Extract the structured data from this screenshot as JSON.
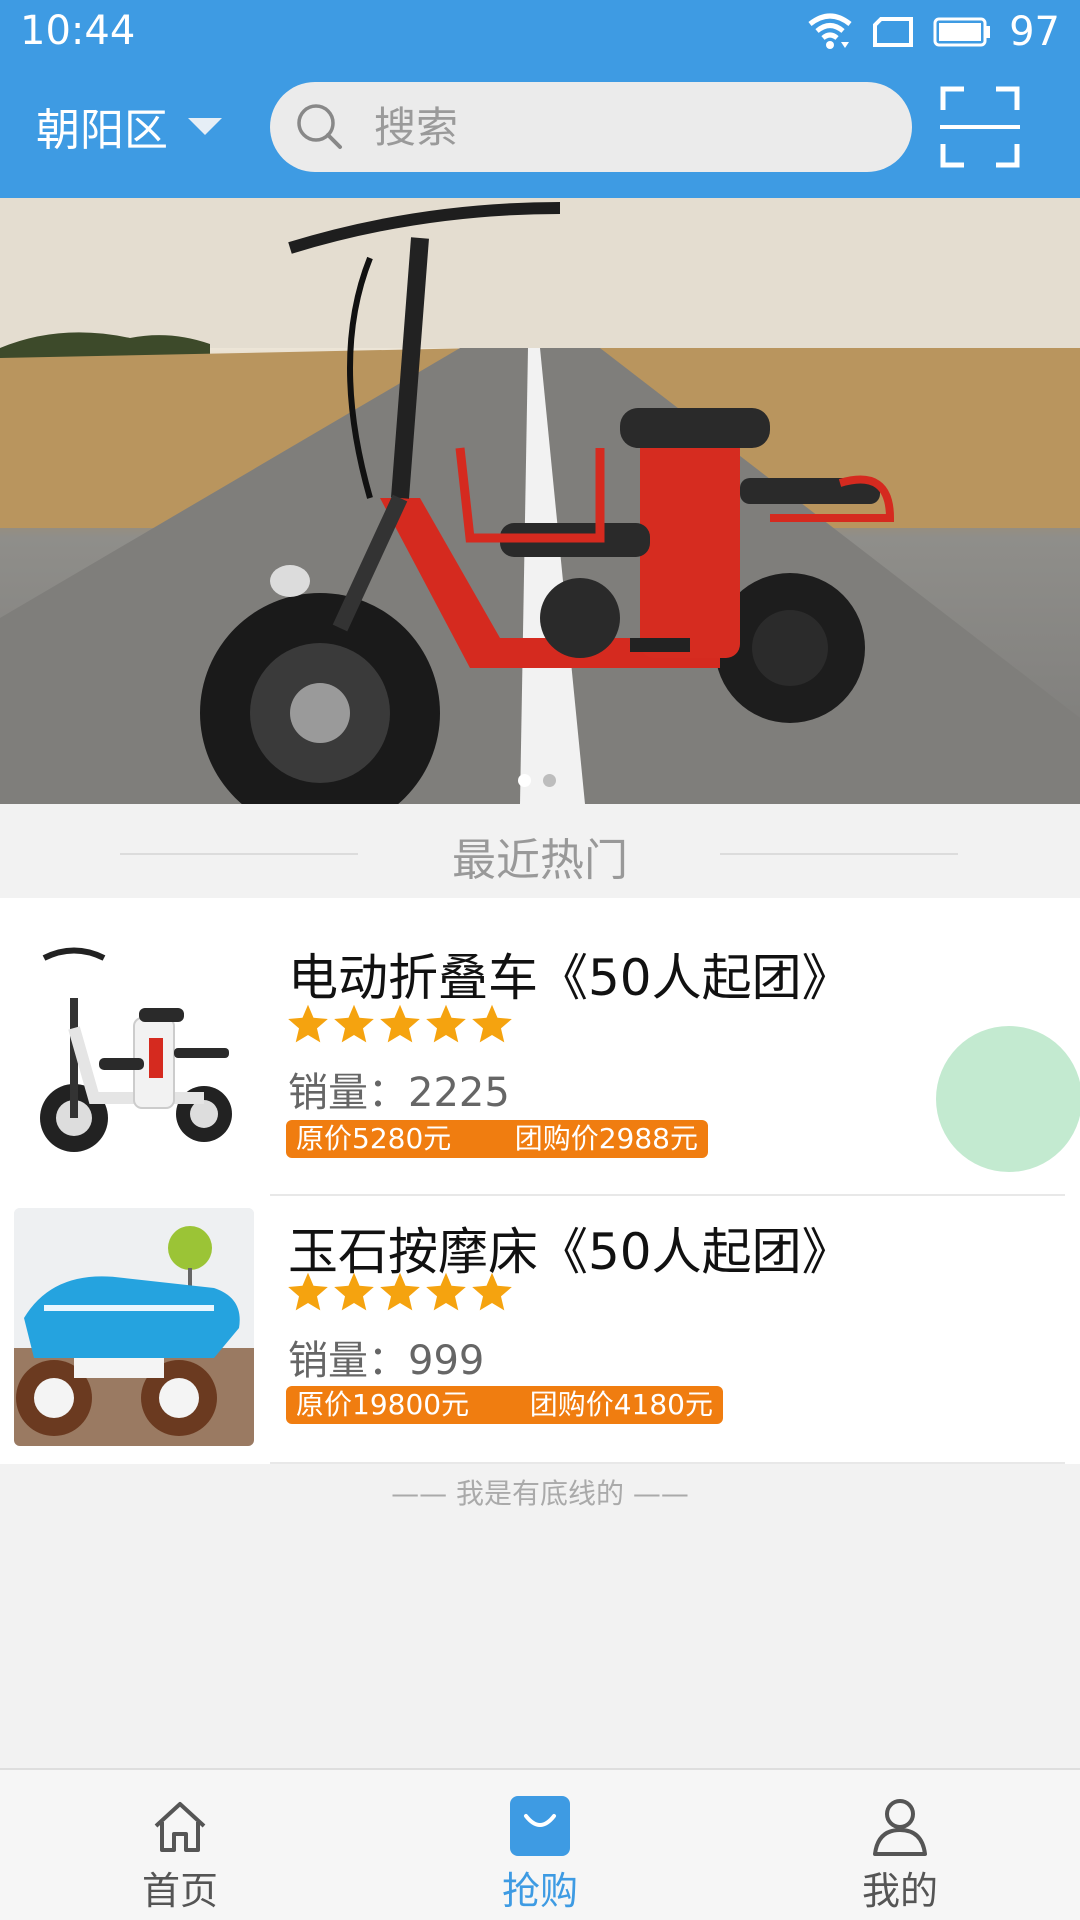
{
  "status_bar": {
    "time": "10:44",
    "battery": "97",
    "icons": [
      "wifi-icon",
      "sim-icon",
      "battery-icon"
    ]
  },
  "header": {
    "location": "朝阳区",
    "search_placeholder": "搜索",
    "icons": [
      "search-icon",
      "scan-icon",
      "caret-down-icon"
    ]
  },
  "banner": {
    "slides_count": 2,
    "active_slide": 1
  },
  "section": {
    "title": "最近热门"
  },
  "products": [
    {
      "title": "电动折叠车《50人起团》",
      "rating": 5,
      "sales": "销量：2225",
      "original_price": "原价5280元",
      "group_price": "团购价2988元"
    },
    {
      "title": "玉石按摩床《50人起团》",
      "rating": 5,
      "sales": "销量：999",
      "original_price": "原价19800元",
      "group_price": "团购价4180元"
    }
  ],
  "list_end_text": "—— 我是有底线的 ——",
  "tabs": [
    {
      "label": "首页",
      "icon": "home-icon",
      "active": false
    },
    {
      "label": "抢购",
      "icon": "shopping-bag-icon",
      "active": true
    },
    {
      "label": "我的",
      "icon": "person-icon",
      "active": false
    }
  ],
  "colors": {
    "primary": "#3e9be3",
    "price_tag": "#f07d10",
    "star": "#f5a30f",
    "float_ball": "#c3ead0"
  }
}
